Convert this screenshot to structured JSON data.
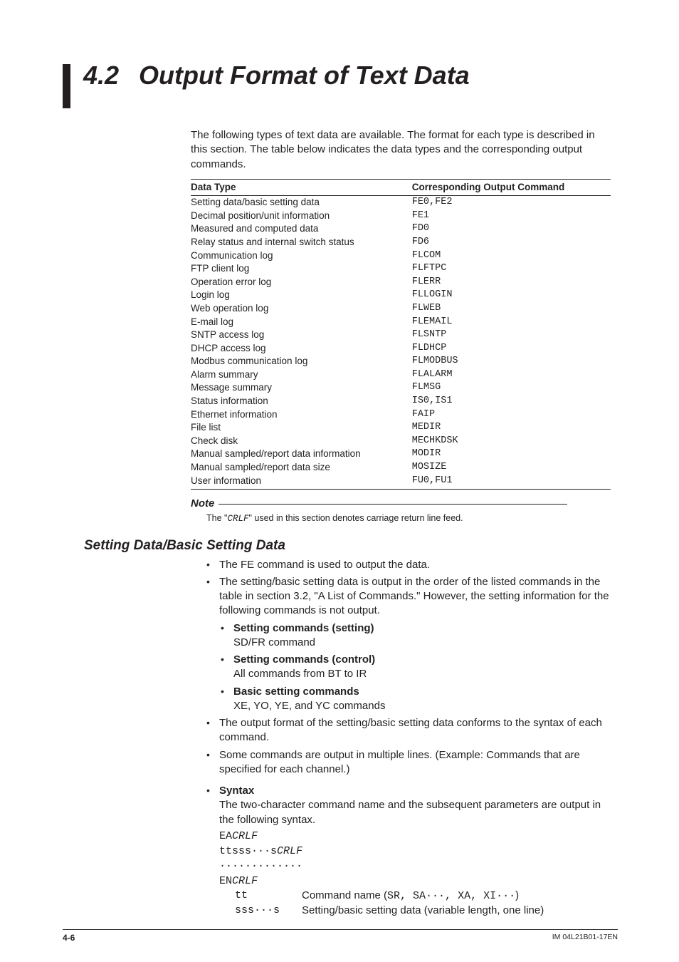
{
  "header": {
    "number": "4.2",
    "title": "Output Format of Text Data"
  },
  "intro": "The following types of text data are available. The format for each type is described in this section. The table below indicates the data types and the corresponding output commands.",
  "table": {
    "headers": [
      "Data Type",
      "Corresponding Output Command"
    ],
    "rows": [
      [
        "Setting data/basic setting data",
        "FE0,FE2"
      ],
      [
        "Decimal position/unit information",
        "FE1"
      ],
      [
        "Measured and computed data",
        "FD0"
      ],
      [
        "Relay status and internal switch status",
        "FD6"
      ],
      [
        "Communication log",
        "FLCOM"
      ],
      [
        "FTP client log",
        "FLFTPC"
      ],
      [
        "Operation error log",
        "FLERR"
      ],
      [
        "Login log",
        "FLLOGIN"
      ],
      [
        "Web operation log",
        "FLWEB"
      ],
      [
        "E-mail log",
        "FLEMAIL"
      ],
      [
        "SNTP access log",
        "FLSNTP"
      ],
      [
        "DHCP access log",
        "FLDHCP"
      ],
      [
        "Modbus communication log",
        "FLMODBUS"
      ],
      [
        "Alarm summary",
        "FLALARM"
      ],
      [
        "Message summary",
        "FLMSG"
      ],
      [
        "Status information",
        "IS0,IS1"
      ],
      [
        "Ethernet information",
        "FAIP"
      ],
      [
        "File list",
        "MEDIR"
      ],
      [
        "Check disk",
        "MECHKDSK"
      ],
      [
        "Manual sampled/report data information",
        "MODIR"
      ],
      [
        "Manual sampled/report data size",
        "MOSIZE"
      ],
      [
        "User information",
        "FU0,FU1"
      ]
    ]
  },
  "note": {
    "label": "Note",
    "text_prefix": "The \"",
    "text_code": "CRLF",
    "text_suffix": "\" used in this section denotes carriage return line feed."
  },
  "h2": "Setting Data/Basic Setting Data",
  "bullets1": [
    "The FE command is used to output the data.",
    "The setting/basic setting data is output in the order of the listed commands in the table in section 3.2, \"A List of Commands.\" However, the setting information for the following commands is not output."
  ],
  "subbullets": [
    {
      "title": "Setting commands (setting)",
      "desc": "SD/FR command"
    },
    {
      "title": "Setting commands (control)",
      "desc": "All commands from BT to IR"
    },
    {
      "title": "Basic setting commands",
      "desc": "XE, YO, YE, and YC commands"
    }
  ],
  "bullets2": [
    "The output format of the setting/basic setting data conforms to the syntax of each command.",
    "Some commands are output in multiple lines. (Example: Commands that are specified for each channel.)"
  ],
  "syntax": {
    "title": "Syntax",
    "desc": "The two-character command name and the subsequent parameters are output in the following syntax.",
    "lines": {
      "l1a": "EA",
      "l1b": "CRLF",
      "l2a": "ttsss···s",
      "l2b": "CRLF",
      "l3": "·············",
      "l4a": "EN",
      "l4b": "CRLF"
    },
    "defs": [
      {
        "k": "tt",
        "v_pre": "Command name (",
        "v_code": "SR, SA···, XA, XI···",
        "v_post": ")"
      },
      {
        "k": "sss···s",
        "v_pre": "Setting/basic setting data (variable length, one line)",
        "v_code": "",
        "v_post": ""
      }
    ]
  },
  "footer": {
    "left": "4-6",
    "right": "IM 04L21B01-17EN"
  }
}
